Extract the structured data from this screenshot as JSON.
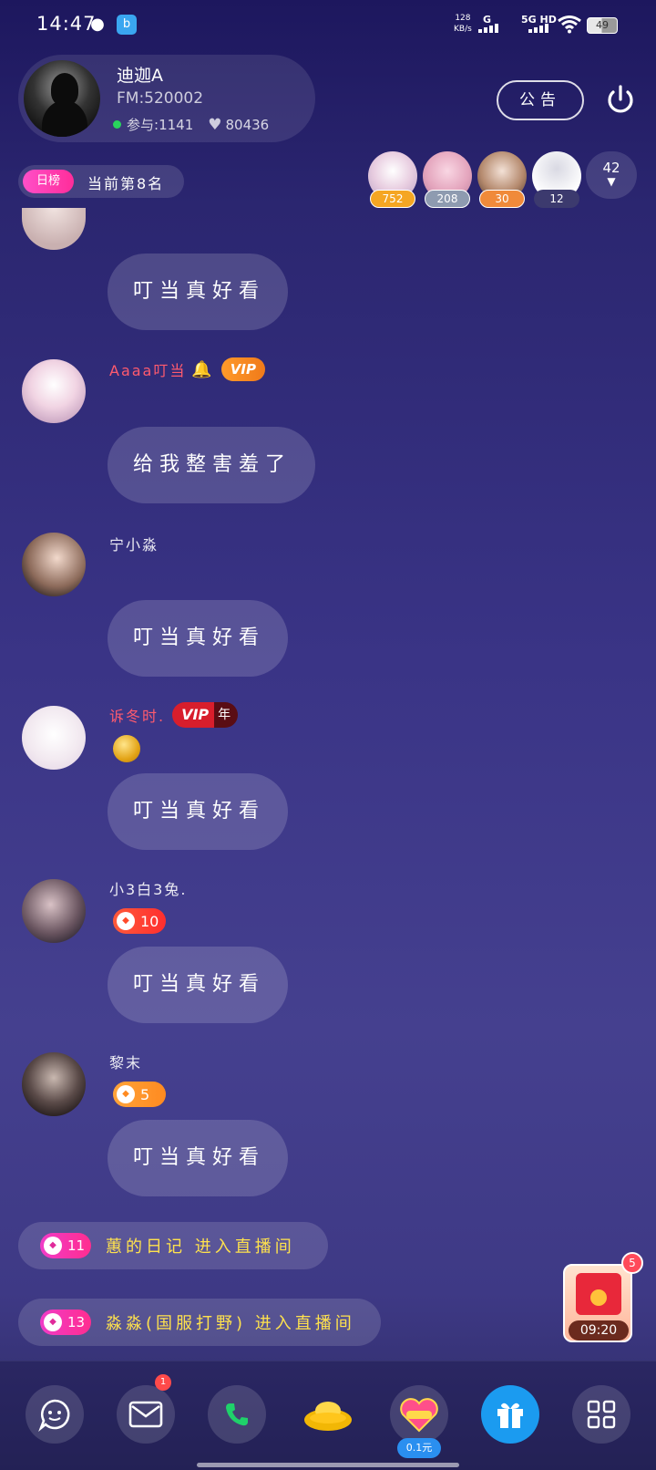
{
  "status_bar": {
    "time": "14:47",
    "net_speed_value": "128",
    "net_speed_unit": "KB/s",
    "network1": "G",
    "network2": "5G HD",
    "battery": "49"
  },
  "host": {
    "name": "迪迦A",
    "fm": "FM:520002",
    "participants_label": "参与:",
    "participants": "1141",
    "likes": "80436"
  },
  "header": {
    "notice_label": "公告"
  },
  "rank": {
    "tag": "日榜",
    "text": "当前第8名"
  },
  "audience": [
    {
      "count": "752",
      "color": "#f5a623"
    },
    {
      "count": "208",
      "color": "#8e9bb0"
    },
    {
      "count": "30",
      "color": "#f08a3a"
    },
    {
      "count": "12",
      "color": "#3c3a6e"
    }
  ],
  "audience_more": "42",
  "messages": [
    {
      "name": "",
      "text": "叮当真好看"
    },
    {
      "name": "Aaaa叮当",
      "text": "给我整害羞了",
      "vip": "VIP"
    },
    {
      "name": "宁小淼",
      "text": "叮当真好看"
    },
    {
      "name": "诉冬时.",
      "text": "叮当真好看",
      "vip": "VIP",
      "vip_year": "年"
    },
    {
      "name": "小3白3兔.",
      "text": "叮当真好看",
      "level": "10"
    },
    {
      "name": "黎末",
      "text": "叮当真好看",
      "level": "5"
    }
  ],
  "entries": [
    {
      "level": "11",
      "text": "蕙的日记 进入直播间"
    },
    {
      "level": "13",
      "text": "淼淼(国服打野) 进入直播间"
    }
  ],
  "envelope": {
    "timer": "09:20",
    "badge": "5"
  },
  "toolbar": {
    "mail_badge": "1",
    "price": "0.1元"
  },
  "colors": {
    "accent_pink": "#ff2d9a",
    "entry_text": "#ffe24d",
    "name_red": "#ff5b6e"
  }
}
